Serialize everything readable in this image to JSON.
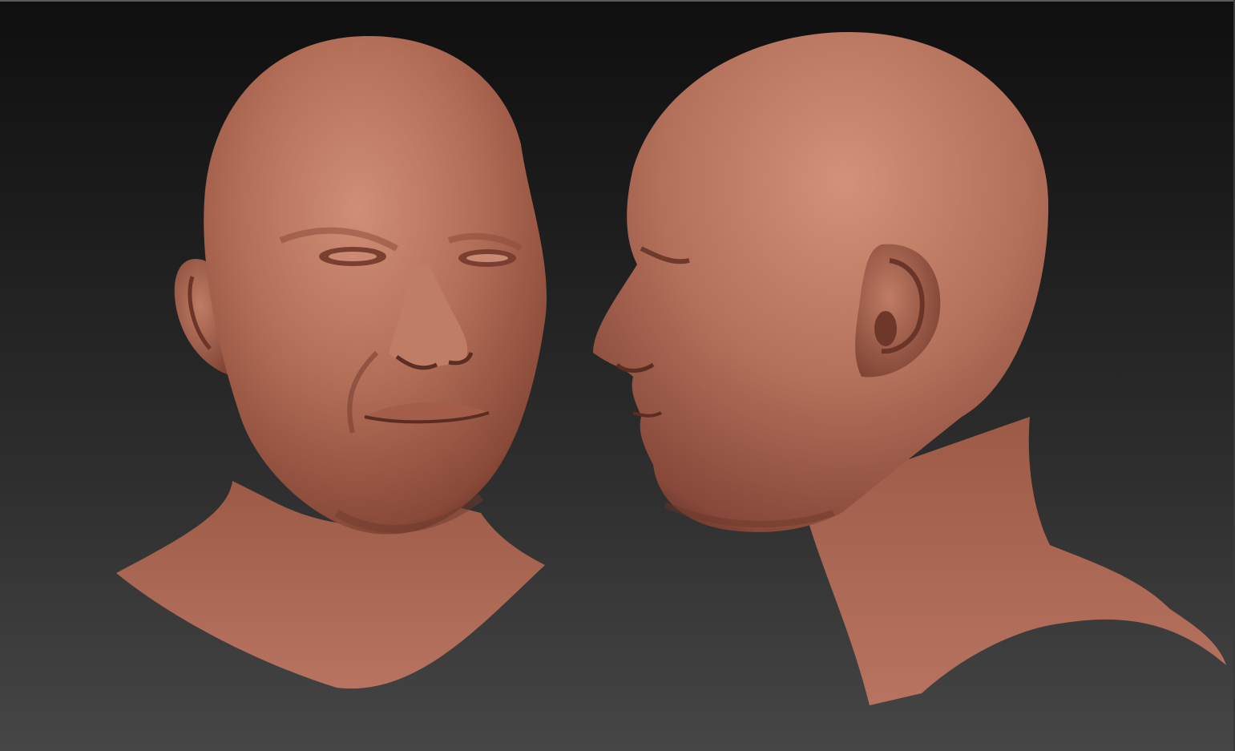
{
  "viewport": {
    "description_free": true,
    "background_top": "#0f0f0f",
    "background_bottom": "#464646"
  },
  "material": {
    "base_color": "#b06b55",
    "highlight_color": "#cf8a72",
    "shadow_color": "#5e3025"
  },
  "models": [
    {
      "id": "front-three-quarter",
      "icon": "sculpt-head-front"
    },
    {
      "id": "side-profile",
      "icon": "sculpt-head-side"
    }
  ]
}
